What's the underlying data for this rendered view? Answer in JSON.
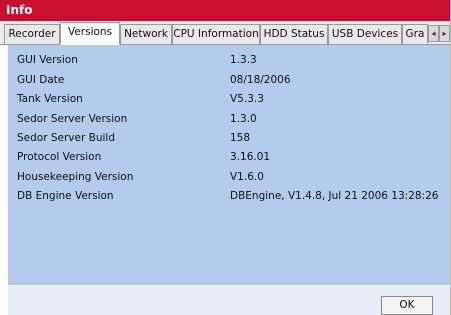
{
  "window": {
    "title": "Info"
  },
  "tabs": [
    "Recorder",
    "Versions",
    "Network",
    "CPU Information",
    "HDD Status",
    "USB Devices",
    "Gra"
  ],
  "active_tab": "Versions",
  "tab_scroll": {
    "left": "◂",
    "right": "▸"
  },
  "versions": [
    {
      "label": "GUI Version",
      "value": "1.3.3"
    },
    {
      "label": "GUI Date",
      "value": "08/18/2006"
    },
    {
      "label": "Tank Version",
      "value": "V5.3.3"
    },
    {
      "label": "Sedor Server Version",
      "value": "1.3.0"
    },
    {
      "label": "Sedor Server Build",
      "value": "158"
    },
    {
      "label": "Protocol Version",
      "value": "3.16.01"
    },
    {
      "label": "Housekeeping Version",
      "value": "V1.6.0"
    },
    {
      "label": "DB Engine Version",
      "value": "DBEngine, V1.4.8, Jul 21 2006 13:28:26"
    }
  ],
  "buttons": {
    "ok": "OK"
  },
  "colors": {
    "title_bar": "#c8102e",
    "content_bg": "#b3cbec"
  }
}
